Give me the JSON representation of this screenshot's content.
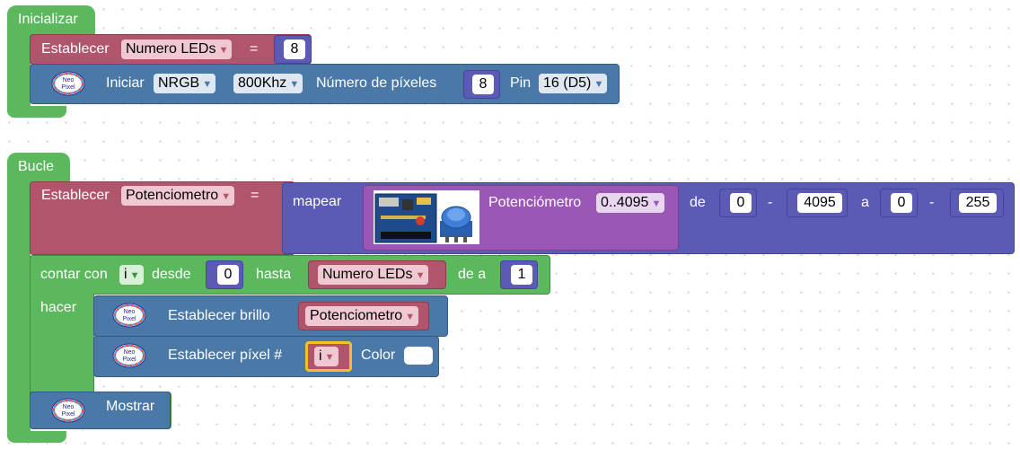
{
  "init": {
    "hat_label": "Inicializar",
    "set_label": "Establecer",
    "var_name": "Numero LEDs",
    "eq": "=",
    "num_leds_value": "8",
    "neo_text_1": "Neo",
    "neo_text_2": "Pixel",
    "start_label": "Iniciar",
    "type_value": "NRGB",
    "freq_value": "800Khz",
    "pixels_label": "Número de píxeles",
    "pixels_value": "8",
    "pin_label": "Pin",
    "pin_value": "16 (D5)"
  },
  "loop": {
    "hat_label": "Bucle",
    "set_label": "Establecer",
    "var_name": "Potenciometro",
    "eq": "=",
    "map_label": "mapear",
    "sensor_label": "Potenciómetro",
    "sensor_range": "0..4095",
    "from_label": "de",
    "from_min": "0",
    "dash": "-",
    "from_max": "4095",
    "to_label": "a",
    "to_min": "0",
    "to_max": "255",
    "count_label": "contar con",
    "count_var": "i",
    "from_word": "desde",
    "count_from": "0",
    "until_word": "hasta",
    "count_to_var": "Numero LEDs",
    "step_word": "de a",
    "step_value": "1",
    "do_label": "hacer",
    "brightness_label": "Establecer brillo",
    "brightness_var": "Potenciometro",
    "pixel_label": "Establecer píxel #",
    "pixel_var": "i",
    "color_label": "Color",
    "color_value": "#ffffff",
    "show_label": "Mostrar"
  }
}
